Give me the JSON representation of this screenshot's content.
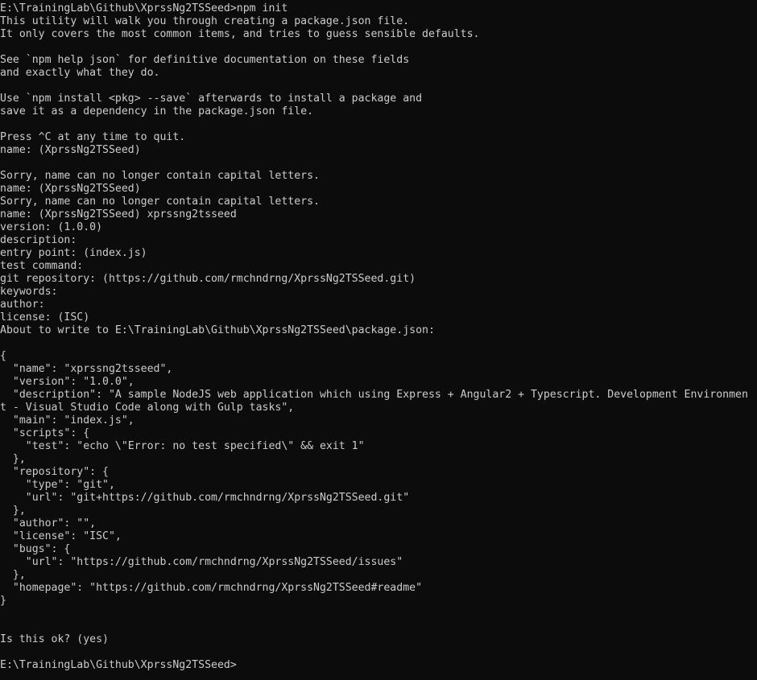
{
  "terminal": {
    "title": "Command Prompt",
    "colors": {
      "background": "#0c0c0c",
      "foreground": "#cccccc"
    },
    "prompt_path": "E:\\TrainingLab\\Github\\XprssNg2TSSeed",
    "command": "npm init",
    "cursor_line": "E:\\TrainingLab\\Github\\XprssNg2TSSeed>",
    "lines": [
      "E:\\TrainingLab\\Github\\XprssNg2TSSeed>npm init",
      "This utility will walk you through creating a package.json file.",
      "It only covers the most common items, and tries to guess sensible defaults.",
      "",
      "See `npm help json` for definitive documentation on these fields",
      "and exactly what they do.",
      "",
      "Use `npm install <pkg> --save` afterwards to install a package and",
      "save it as a dependency in the package.json file.",
      "",
      "Press ^C at any time to quit.",
      "name: (XprssNg2TSSeed)",
      "",
      "Sorry, name can no longer contain capital letters.",
      "name: (XprssNg2TSSeed)",
      "Sorry, name can no longer contain capital letters.",
      "name: (XprssNg2TSSeed) xprssng2tsseed",
      "version: (1.0.0)",
      "description:",
      "entry point: (index.js)",
      "test command:",
      "git repository: (https://github.com/rmchndrng/XprssNg2TSSeed.git)",
      "keywords:",
      "author:",
      "license: (ISC)",
      "About to write to E:\\TrainingLab\\Github\\XprssNg2TSSeed\\package.json:",
      "",
      "{",
      "  \"name\": \"xprssng2tsseed\",",
      "  \"version\": \"1.0.0\",",
      "  \"description\": \"A sample NodeJS web application which using Express + Angular2 + Typescript. Development Environmen",
      "t - Visual Studio Code along with Gulp tasks\",",
      "  \"main\": \"index.js\",",
      "  \"scripts\": {",
      "    \"test\": \"echo \\\"Error: no test specified\\\" && exit 1\"",
      "  },",
      "  \"repository\": {",
      "    \"type\": \"git\",",
      "    \"url\": \"git+https://github.com/rmchndrng/XprssNg2TSSeed.git\"",
      "  },",
      "  \"author\": \"\",",
      "  \"license\": \"ISC\",",
      "  \"bugs\": {",
      "    \"url\": \"https://github.com/rmchndrng/XprssNg2TSSeed/issues\"",
      "  },",
      "  \"homepage\": \"https://github.com/rmchndrng/XprssNg2TSSeed#readme\"",
      "}",
      "",
      "",
      "Is this ok? (yes)",
      "",
      "E:\\TrainingLab\\Github\\XprssNg2TSSeed>"
    ]
  }
}
